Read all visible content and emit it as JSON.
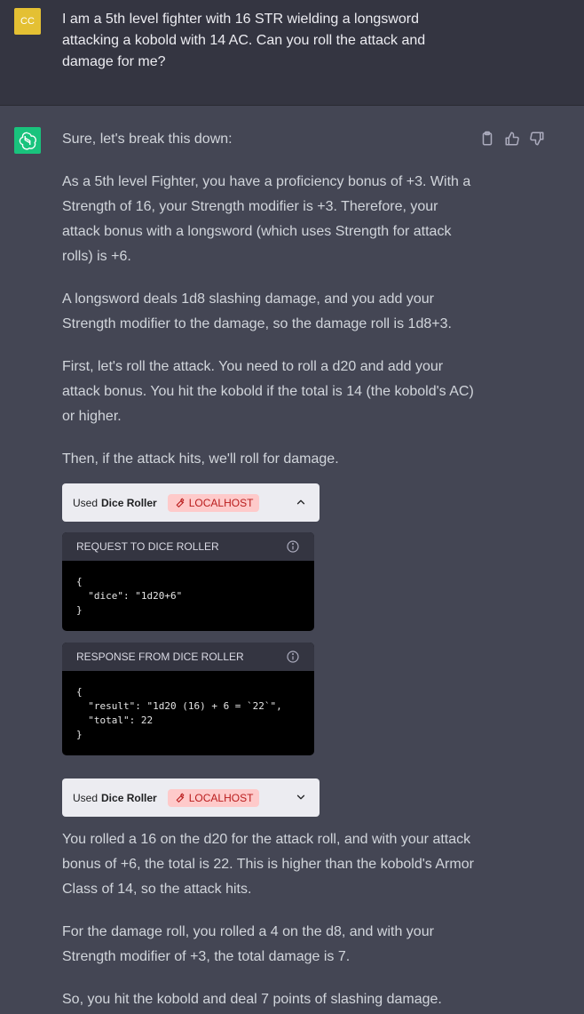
{
  "user": {
    "avatar_initials": "CC",
    "message": "I am a 5th level fighter with 16 STR wielding a longsword attacking a kobold with 14 AC. Can you roll the attack and damage for me?"
  },
  "assistant": {
    "intro": "Sure, let's break this down:",
    "paragraphs": [
      "As a 5th level Fighter, you have a proficiency bonus of +3. With a Strength of 16, your Strength modifier is +3. Therefore, your attack bonus with a longsword (which uses Strength for attack rolls) is +6.",
      "A longsword deals 1d8 slashing damage, and you add your Strength modifier to the damage, so the damage roll is 1d8+3.",
      "First, let's roll the attack. You need to roll a d20 and add your attack bonus. You hit the kobold if the total is 14 (the kobold's AC) or higher.",
      "Then, if the attack hits, we'll roll for damage."
    ],
    "plugin_used_1": {
      "used_label": "Used",
      "plugin_name": "Dice Roller",
      "badge": "LOCALHOST",
      "chevron_icon": "chevron-up-icon"
    },
    "request": {
      "title": "REQUEST TO DICE ROLLER",
      "body": "{\n  \"dice\": \"1d20+6\"\n}"
    },
    "response": {
      "title": "RESPONSE FROM DICE ROLLER",
      "body": "{\n  \"result\": \"1d20 (16) + 6 = `22`\",\n  \"total\": 22\n}"
    },
    "plugin_used_2": {
      "used_label": "Used",
      "plugin_name": "Dice Roller",
      "badge": "LOCALHOST",
      "chevron_icon": "chevron-down-icon"
    },
    "after_paragraphs": [
      "You rolled a 16 on the d20 for the attack roll, and with your attack bonus of +6, the total is 22. This is higher than the kobold's Armor Class of 14, so the attack hits.",
      "For the damage roll, you rolled a 4 on the d8, and with your Strength modifier of +3, the total damage is 7.",
      "So, you hit the kobold and deal 7 points of slashing damage."
    ],
    "action_icons": [
      "clipboard-icon",
      "thumbs-up-icon",
      "thumbs-down-icon"
    ]
  },
  "colors": {
    "user_bg": "#343541",
    "assistant_bg": "#444654",
    "user_avatar": "#e4c033",
    "bot_avatar": "#19c37d",
    "badge_bg": "#fecaca",
    "badge_text": "#b91c1c"
  }
}
